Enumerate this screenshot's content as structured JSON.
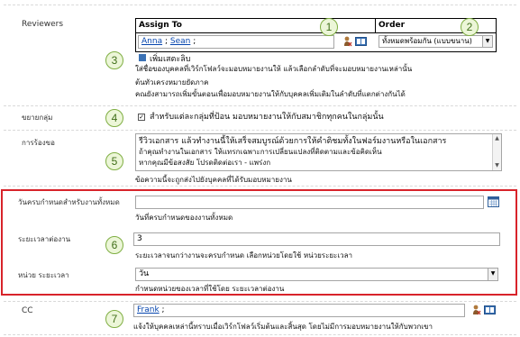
{
  "reviewers": {
    "label": "Reviewers",
    "assign_to_header": "Assign To",
    "order_header": "Order",
    "people": [
      {
        "name": "Anna",
        "separator": " ; "
      },
      {
        "name": "Sean",
        "separator": " ;"
      }
    ],
    "order_value": "ทั้งหมดพร้อมกัน (แบบขนาน)",
    "add_stage_link": "เพิ่มเสตะลิบ",
    "help_lines": [
      "ใส่ชื่อของบุคคลที่เวิร์กโฟลว์จะมอบหมายงานให้ แล้วเลือกลำดับที่จะมอบหมายงานเหล่านั้น",
      "ต้นทัวเครงหมายยัดภาค",
      "คณยังสามารถเพิ่มขั้นตอนเพื่อมอบหมายงานให้กับบุคคลเพิ่มเติมในลำดับที่แตกต่างกันได้"
    ]
  },
  "expand_groups": {
    "label": "ขยายกลุ่ม",
    "checked": true,
    "check_label": "สำหรับแต่ละกลุ่มที่ป้อน มอบหมายงานให้กับสมาชิกทุกคนในกลุ่มนั้น"
  },
  "request": {
    "label": "การร้องขอ",
    "lines": [
      "รีวิวเอกสาร แล้วทำงานนี้ให้เสร็จสมบูรณ์ด้วยการให้คำติชมทั้งในฟอร์มงานหรือในเอกสาร",
      "ถ้าคุณทำงานในเอกสาร ให้แทรกเฉพาะการเปลี่ยนแปลงที่ติดตามและข้อคิดเห็น",
      "หากคุณมีข้อสงสัย โปรดติดต่อเรา - แพร่งก",
      "ข้อความนี้จะถูกส่งไปยังบุคคลที่ได้รับมอบหมายงาน"
    ]
  },
  "due_all": {
    "label": "วันครบกำหนดสำหรับงานทั้งหมด",
    "value": "",
    "hint": "วันที่ครบกำหนดของงานทั้งหมด"
  },
  "duration": {
    "label": "ระยะเวลาต่องาน",
    "value": "3",
    "hint": "ระยะเวลาจนกว่างานจะครบกำหนด เลือกหน่วยโดยใช้ หน่วยระยะเวลา"
  },
  "duration_unit": {
    "label": "หน่วย ระยะเวลา",
    "value": "วัน",
    "hint": "กำหนดหน่วยของเวลาที่ใช้โดย ระยะเวลาต่องาน"
  },
  "cc": {
    "label": "CC",
    "people": [
      {
        "name": "Frank",
        "separator": " ;"
      }
    ],
    "hint": "แจ้งให้บุคคลเหล่านี้ทราบเมื่อเวิร์กโฟลว์เริ่มต้นและสิ้นสุด โดยไม่มีการมอบหมายงานให้กับพวกเขา"
  },
  "callouts": [
    "1",
    "2",
    "3",
    "4",
    "5",
    "6",
    "7"
  ],
  "colors": {
    "highlight_border": "#d8232a",
    "callout_fill": "#ecf6d8",
    "callout_text": "#3f6e18",
    "link": "#0645ad"
  },
  "icons": [
    "check-names-icon",
    "address-book-icon",
    "calendar-icon",
    "dropdown-arrow-icon",
    "checkbox-check-icon",
    "scroll-up-icon",
    "scroll-down-icon",
    "add-stage-icon"
  ]
}
